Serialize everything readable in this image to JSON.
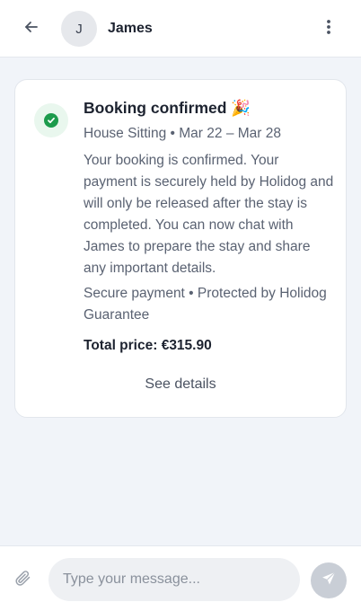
{
  "header": {
    "contact_initial": "J",
    "contact_name": "James",
    "icons": {
      "back": "arrow-left-icon",
      "more": "more-vertical-icon"
    }
  },
  "booking_card": {
    "status_icon": "check-circle-icon",
    "title": "Booking confirmed 🎉",
    "service": "House Sitting",
    "separator": "•",
    "dates": "Mar 22 – Mar 28",
    "message": "Your booking is confirmed. Your payment is securely held by Holidog and will only be released after the stay is completed. You can now chat with James to prepare the stay and share any important details.",
    "secure_note": "Secure payment • Protected by Holidog Guarantee",
    "total_label": "Total price: €315.90",
    "details_link": "See details"
  },
  "composer": {
    "placeholder": "Type your message...",
    "value": "",
    "icons": {
      "attach": "paperclip-icon",
      "send": "send-icon"
    }
  },
  "colors": {
    "background": "#f1f4f9",
    "card": "#ffffff",
    "success_green": "#1c9b4c",
    "success_bg": "#e9f7ee",
    "send_disabled": "#c9ced6"
  }
}
